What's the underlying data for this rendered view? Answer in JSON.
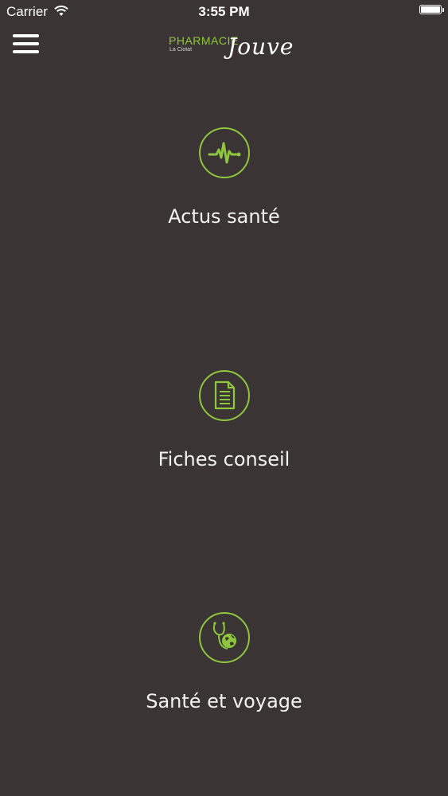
{
  "status_bar": {
    "carrier": "Carrier",
    "time": "3:55 PM"
  },
  "header": {
    "logo_pharmacie": "PHARMACIE",
    "logo_city": "La Ciotat",
    "logo_name": "Jouve"
  },
  "menu": {
    "items": [
      {
        "label": "Actus santé",
        "icon": "heartbeat-icon"
      },
      {
        "label": "Fiches conseil",
        "icon": "document-icon"
      },
      {
        "label": "Santé et voyage",
        "icon": "globe-stethoscope-icon"
      }
    ]
  },
  "colors": {
    "accent": "#8ec63f",
    "background": "#3a3534",
    "text": "#ffffff"
  }
}
